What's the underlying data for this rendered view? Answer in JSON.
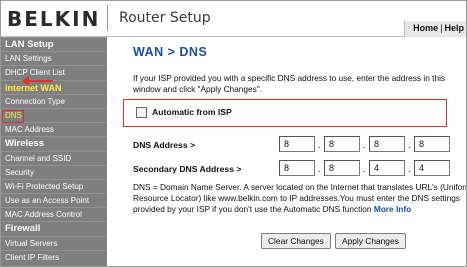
{
  "header": {
    "brand": "BELKIN",
    "app_title": "Router Setup",
    "nav_home": "Home",
    "nav_sep": "|",
    "nav_help": "Help"
  },
  "sidebar": {
    "lan_setup": "LAN Setup",
    "lan_settings": "LAN Settings",
    "dhcp_client_list": "DHCP Client List",
    "internet_wan": "Internet WAN",
    "connection_type": "Connection Type",
    "dns": "DNS",
    "mac_address": "MAC Address",
    "wireless": "Wireless",
    "channel_ssid": "Channel and SSID",
    "security": "Security",
    "wifi_protected_setup": "Wi-Fi Protected Setup",
    "use_as_access_point": "Use as an Access Point",
    "mac_address_control": "MAC Address Control",
    "firewall": "Firewall",
    "virtual_servers": "Virtual Servers",
    "client_ip_filters": "Client IP Filters"
  },
  "main": {
    "title": "WAN > DNS",
    "intro": "If your ISP provided you with a specific DNS address to use, enter the address in this window and click \"Apply Changes\".",
    "auto_label": "Automatic from ISP",
    "dns_label": "DNS Address >",
    "dns_octets": [
      "8",
      "8",
      "8",
      "8"
    ],
    "secondary_label": "Secondary DNS Address >",
    "secondary_octets": [
      "8",
      "8",
      "4",
      "4"
    ],
    "description": "DNS = Domain Name Server. A server located on the Internet that translates URL's (Uniform Resource Locator) like www.belkin.com to IP addresses.You must enter the DNS settings provided by your ISP if you don't use the Automatic DNS function",
    "more_info": "More Info",
    "clear_button": "Clear Changes",
    "apply_button": "Apply Changes"
  },
  "colors": {
    "accent_blue": "#1d4fa3",
    "sidebar_bg": "#7f7f7f",
    "sidebar_highlight": "#ffe94a",
    "annotation_red": "#e0312d"
  }
}
